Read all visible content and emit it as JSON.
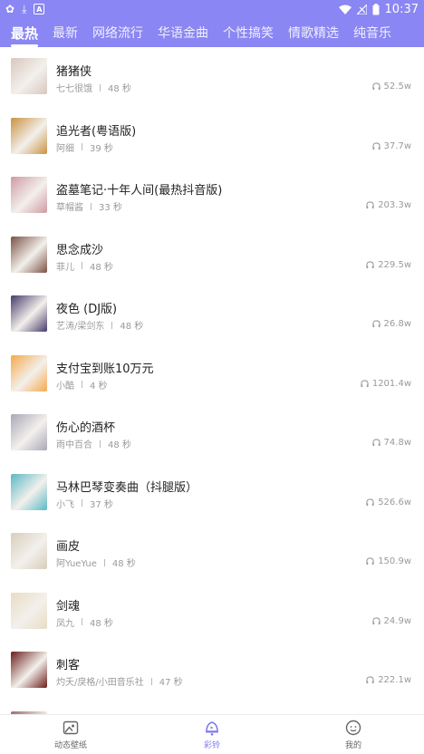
{
  "status": {
    "time": "10:37",
    "notif_icons": [
      "app-icon",
      "download-icon",
      "a-icon"
    ]
  },
  "tabs": [
    "最热",
    "最新",
    "网络流行",
    "华语金曲",
    "个性搞笑",
    "情歌精选",
    "纯音乐"
  ],
  "songs": [
    {
      "title": "猪猪侠",
      "artist": "七七很饿",
      "duration": "48 秒",
      "plays": "52.5w",
      "cover": "#d8c7bf"
    },
    {
      "title": "追光者(粤语版)",
      "artist": "阿细",
      "duration": "39 秒",
      "plays": "37.7w",
      "cover": "#c99243"
    },
    {
      "title": "盗墓笔记·十年人间(最热抖音版)",
      "artist": "草帽酱",
      "duration": "33 秒",
      "plays": "203.3w",
      "cover": "#cf9aa2"
    },
    {
      "title": "思念成沙",
      "artist": "菲儿",
      "duration": "48 秒",
      "plays": "229.5w",
      "cover": "#7a5245"
    },
    {
      "title": "夜色 (DJ版)",
      "artist": "艺涛/梁剑东",
      "duration": "48 秒",
      "plays": "26.8w",
      "cover": "#463b69"
    },
    {
      "title": "支付宝到账10万元",
      "artist": "小酷",
      "duration": "4 秒",
      "plays": "1201.4w",
      "cover": "#f5a94d"
    },
    {
      "title": "伤心的酒杯",
      "artist": "雨中百合",
      "duration": "48 秒",
      "plays": "74.8w",
      "cover": "#a9a8b8"
    },
    {
      "title": "马林巴琴变奏曲（抖腿版）",
      "artist": "小飞",
      "duration": "37 秒",
      "plays": "526.6w",
      "cover": "#5bb8c6"
    },
    {
      "title": "画皮",
      "artist": "阿YueYue",
      "duration": "48 秒",
      "plays": "150.9w",
      "cover": "#d7cdbb"
    },
    {
      "title": "剑魂",
      "artist": "凤九",
      "duration": "48 秒",
      "plays": "24.9w",
      "cover": "#e8dcc4"
    },
    {
      "title": "刺客",
      "artist": "灼夭/戾格/小田音乐社",
      "duration": "47 秒",
      "plays": "222.1w",
      "cover": "#6b1f1a"
    },
    {
      "title": "",
      "artist": "",
      "duration": "",
      "plays": "",
      "cover": "#9a6b68"
    }
  ],
  "nav": [
    {
      "label": "动态壁纸",
      "icon": "wallpaper-icon",
      "active": false
    },
    {
      "label": "彩铃",
      "icon": "ringtone-icon",
      "active": true
    },
    {
      "label": "我的",
      "icon": "profile-icon",
      "active": false
    }
  ],
  "colors": {
    "accent": "#8a86f3",
    "nav_active": "#7d78ee"
  }
}
